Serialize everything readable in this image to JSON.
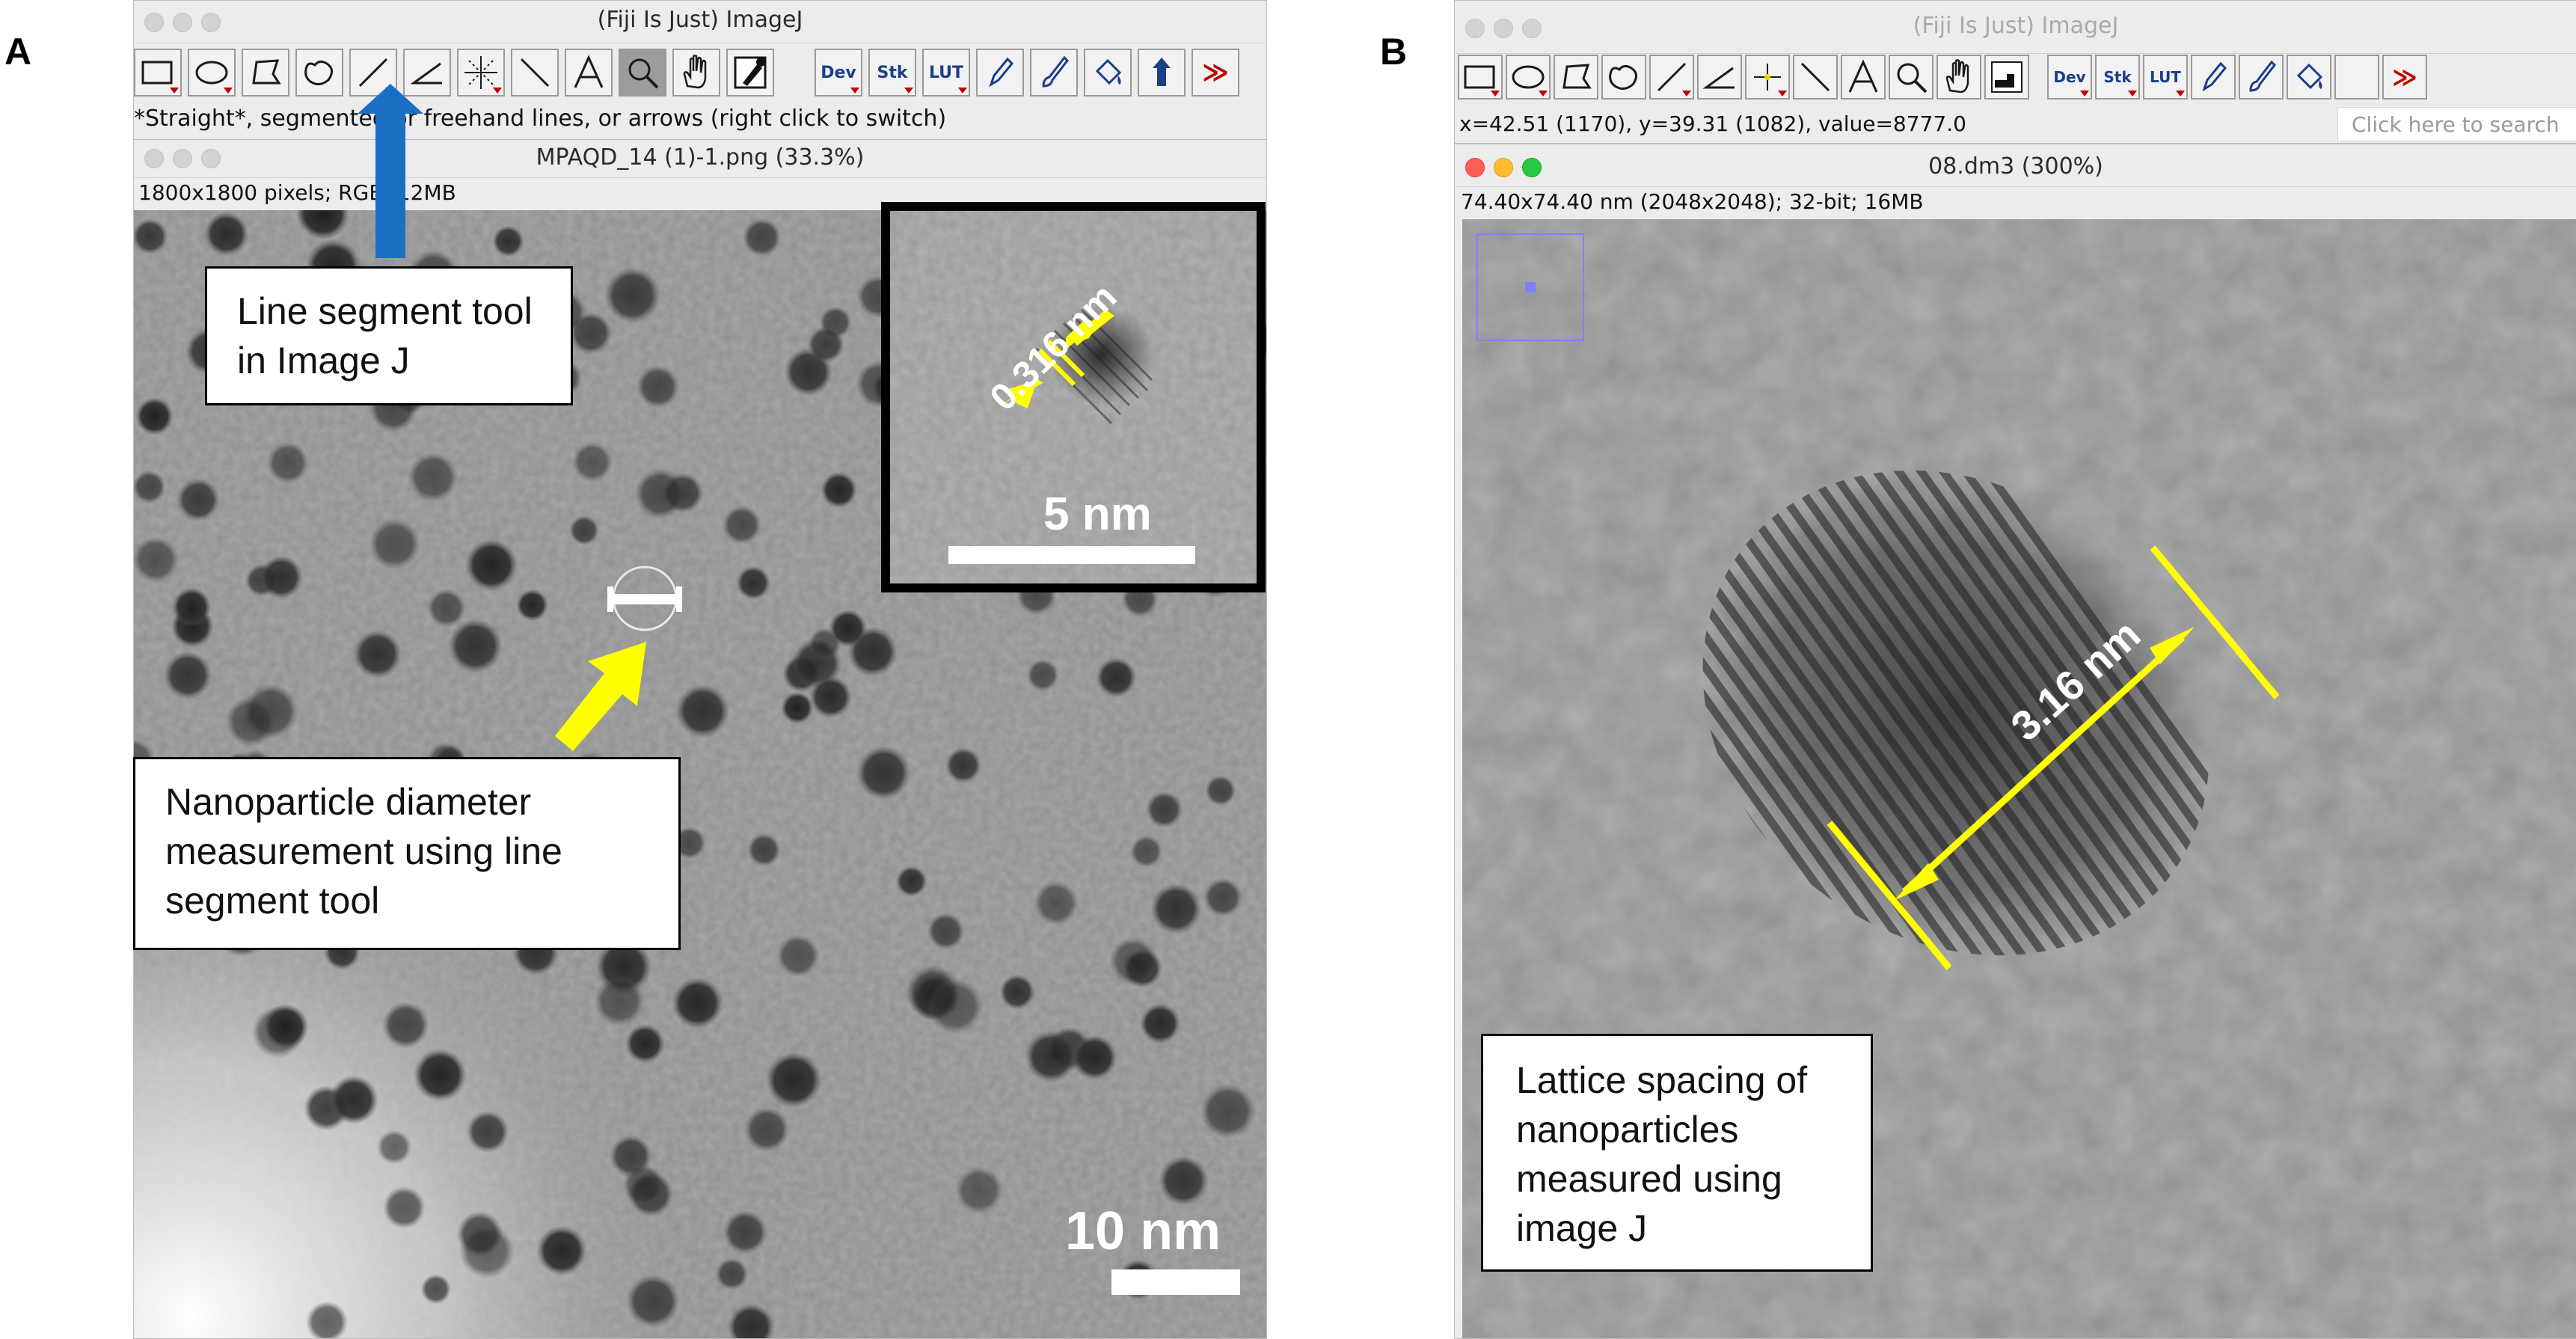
{
  "panels": {
    "a_label": "A",
    "b_label": "B"
  },
  "left": {
    "main_title": "(Fiji Is Just) ImageJ",
    "tool_labels": {
      "dev": "Dev",
      "stk": "Stk",
      "lut": "LUT",
      "more": "≫"
    },
    "status": "*Straight*, segmented or freehand lines, or arrows (right click to switch)",
    "image_window_title": "MPAQD_14 (1)-1.png (33.3%)",
    "image_info": "1800x1800 pixels; RGB; 12MB",
    "callout_tool": "Line segment tool in Image J",
    "callout_measure": "Nanoparticle diameter measurement using line segment tool",
    "scale_main": "10 nm",
    "inset_scale": "5 nm",
    "inset_measure": "0.316 nm"
  },
  "right": {
    "main_title": "(Fiji Is Just) ImageJ",
    "tool_labels": {
      "dev": "Dev",
      "stk": "Stk",
      "lut": "LUT",
      "more": "≫"
    },
    "status": "x=42.51 (1170), y=39.31 (1082), value=8777.0",
    "search_placeholder": "Click here to search",
    "image_window_title": "08.dm3 (300%)",
    "image_info": "74.40x74.40 nm (2048x2048); 32-bit; 16MB",
    "measure_label": "3.16 nm",
    "callout_lattice": "Lattice spacing of nanoparticles measured using image J"
  },
  "colors": {
    "annotation_yellow": "#ffff00",
    "arrow_blue": "#1a6fc4",
    "window_chrome": "#ececec",
    "close_red": "#fe5f57",
    "minimize_yellow": "#febc2e",
    "zoom_green": "#28c840"
  },
  "icons": [
    "rectangle-icon",
    "oval-icon",
    "polygon-icon",
    "freehand-icon",
    "line-icon",
    "angle-icon",
    "point-icon",
    "wand-icon",
    "text-icon",
    "magnifier-icon",
    "hand-icon",
    "color-picker-icon",
    "pencil-icon",
    "brush-icon",
    "flood-fill-icon",
    "arrow-icon"
  ]
}
